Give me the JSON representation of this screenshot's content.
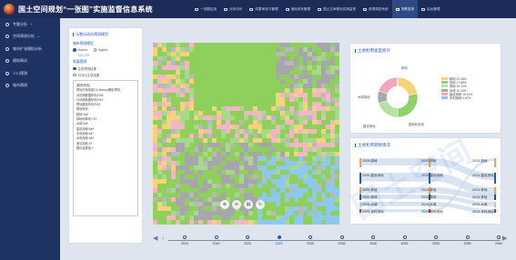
{
  "app": {
    "title": "国土空间规划“一张图”实施监督信息系统"
  },
  "topnav": [
    {
      "label": "一张图应用",
      "icon": "map-icon"
    },
    {
      "label": "分析评价",
      "icon": "chart-icon"
    },
    {
      "label": "成果审查与管理",
      "icon": "folder-icon"
    },
    {
      "label": "指标体系管理",
      "icon": "list-icon"
    },
    {
      "label": "国土空间规划实施监督",
      "icon": "monitor-icon"
    },
    {
      "label": "资源调查系统",
      "icon": "survey-icon"
    },
    {
      "label": "决策支持",
      "icon": "decision-icon",
      "active": true
    },
    {
      "label": "后台管理",
      "icon": "settings-icon"
    }
  ],
  "sidebar": [
    {
      "label": "专题分析",
      "icon": "analysis-icon",
      "chev": true
    },
    {
      "label": "空间预测分析",
      "icon": "predict-icon",
      "chev": true
    },
    {
      "label": "城市扩张模拟分析",
      "icon": "expansion-icon",
      "chev": false
    },
    {
      "label": "模拟情况",
      "icon": "simulation-icon",
      "chev": false
    },
    {
      "label": "人口预测",
      "icon": "population-icon",
      "chev": false
    },
    {
      "label": "城市预测",
      "icon": "city-icon",
      "chev": false
    }
  ],
  "left_panel": {
    "title": "元胞自动机预测模型",
    "transfer_label": "城市预测模型",
    "model_options": [
      "Markov",
      "logistic"
    ],
    "model_selected": 0,
    "input_value": "121.070",
    "output_label": "发展预测",
    "output_options": [
      "生成预测结果",
      "可对比生成结果"
    ],
    "desc": "[模型说明]\n预测方案采用CA-Markov耦合预测，\n对初期数据年份2005\n与训练数据年份2010\n预测基准年份2015\n预测年份:\n耕地:3a5\n林地和草地:7a7\n水域:5a9\n建设用地:5a9\n未利用地:3a7\n水利用地:3a2\n渔业用地:7a\n模约运算值:7"
  },
  "map": {
    "tools": [
      {
        "name": "zoom-in-icon",
        "glyph": "⊕"
      },
      {
        "name": "zoom-out-icon",
        "glyph": "⊖"
      },
      {
        "name": "layers-icon",
        "glyph": "▤"
      },
      {
        "name": "refresh-icon",
        "glyph": "↻"
      }
    ]
  },
  "timeline": {
    "prev": "◀",
    "next": "▶",
    "years": [
      "2010",
      "2015",
      "2020",
      "2025",
      "2030",
      "2035",
      "2040",
      "2045",
      "2050",
      "2055",
      "2060"
    ],
    "active_index": 3
  },
  "landuse_card": {
    "title": "土地利用类型统计",
    "chart_data": {
      "type": "pie",
      "categories": [
        "耕地",
        "林地",
        "草地",
        "水域",
        "建设用地",
        "未利用地"
      ],
      "values": [
        22.08,
        27.89,
        20.12,
        10.1,
        19.14,
        0.62
      ],
      "colors": [
        "#fbd277",
        "#8fd26a",
        "#b7e2a0",
        "#a8a8ad",
        "#f7a5b8",
        "#8ec7ef"
      ],
      "legend_labels": [
        "耕地 22.08%",
        "林地 27.89%",
        "草地 20.12%",
        "水域 10.10%",
        "建设用地 19.14%",
        "未利用地 0.62%"
      ],
      "slice_labels": [
        {
          "text": "水域用地",
          "at": "left"
        },
        {
          "text": "耕地",
          "at": "top"
        },
        {
          "text": "建设用地",
          "at": "bottom-left"
        },
        {
          "text": "国地利用地",
          "at": "bottom-right"
        }
      ]
    }
  },
  "transfer_card": {
    "title": "土地利用转移情况",
    "chart_data": {
      "type": "sankey",
      "left_labels": [
        "2005-耕地",
        "2005-建设用地",
        "2005-林地",
        "2005-草地",
        "2005-水域",
        "2005-未利用地"
      ],
      "mid_labels": [
        "2010-耕地",
        "2010-建设用地",
        "2010-林地",
        "2010-草地",
        "2010-水域",
        "2010-未利用地"
      ],
      "right_labels": [
        "2015-耕地",
        "2015-建设用地",
        "2015-林地",
        "2015-草地",
        "2015-水域",
        "2015-未利用地"
      ],
      "node_colors": [
        "#f0a259",
        "#1f5e9e",
        "#f39b44",
        "#2a4f8a",
        "#c0c6d0",
        "#c0392b"
      ]
    }
  },
  "watermark": "国土空间"
}
